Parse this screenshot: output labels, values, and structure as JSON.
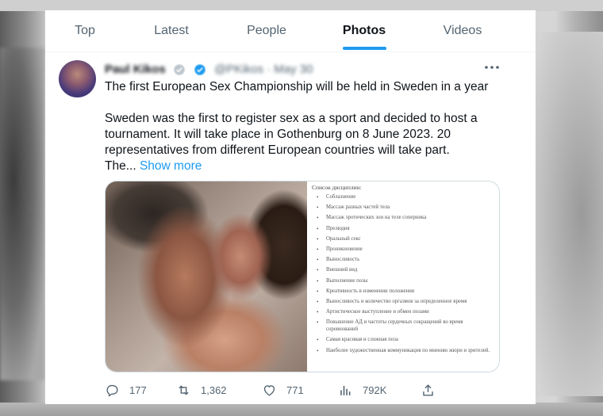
{
  "tabs": [
    {
      "label": "Top",
      "active": false
    },
    {
      "label": "Latest",
      "active": false
    },
    {
      "label": "People",
      "active": false
    },
    {
      "label": "Photos",
      "active": true
    },
    {
      "label": "Videos",
      "active": false
    }
  ],
  "tweet": {
    "author_name": "Paul Kikos",
    "handle": "@PKikos · May 30",
    "headline": "The first European Sex Championship will be held in Sweden in a year",
    "body": "Sweden was the first to register sex as a sport and decided to host a tournament. It will take place in Gothenburg on 8 June 2023. 20 representatives from different European countries will take part.",
    "truncated_tail": "The...",
    "show_more": "Show more",
    "image": {
      "list_title": "Список дисциплин:",
      "list_items": [
        "Соблазнение",
        "Массаж разных частей тела",
        "Массаж эротических зон на теле соперника",
        "Прелюдия",
        "Оральный секс",
        "Проникновение",
        "Выносливость",
        "Внешний вид",
        "Выполнение позы",
        "Креативность в изменении положения",
        "Выносливость и количество оргазмов за определенное время",
        "Артистическое выступление и обмен позами",
        "Повышение АД и частоты сердечных сокращений во время соревнований",
        "Самая красивая и сложная поза",
        "Наиболее художественная коммуникация по мнению жюри и зрителей."
      ]
    },
    "stats": {
      "replies": "177",
      "retweets": "1,362",
      "likes": "771",
      "views": "792K"
    }
  },
  "icons": {
    "verified": "verified-badge-icon",
    "more": "more-options-icon",
    "reply": "reply-icon",
    "retweet": "retweet-icon",
    "like": "heart-icon",
    "views": "analytics-icon",
    "share": "share-icon"
  },
  "colors": {
    "accent": "#1d9bf0",
    "text_primary": "#0f1419",
    "text_secondary": "#536471"
  }
}
